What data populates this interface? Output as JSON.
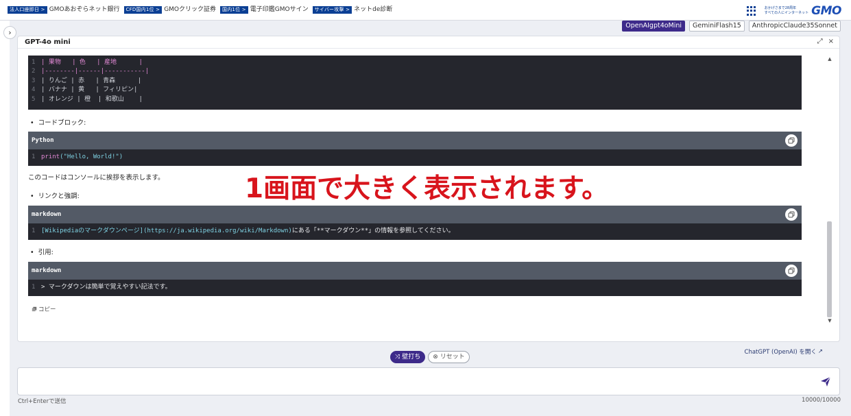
{
  "topbar": {
    "links": [
      {
        "tag": "法人口座即日 >",
        "label": "GMOあおぞらネット銀行"
      },
      {
        "tag": "CFD国内1位 >",
        "label": "GMOクリック証券"
      },
      {
        "tag": "国内1位 >",
        "label": "電子印鑑GMOサイン"
      },
      {
        "tag": "サイバー攻撃 >",
        "label": "ネットde診断"
      }
    ],
    "anniv_line1": "おかげさまで28周年",
    "anniv_line2": "すべての人にインターネット",
    "logo": "GMO"
  },
  "model_tabs": [
    {
      "label": "OpenAIgpt4oMini",
      "active": true
    },
    {
      "label": "GeminiFlash15",
      "active": false
    },
    {
      "label": "AnthropicClaude35Sonnet",
      "active": false
    }
  ],
  "panel": {
    "title": "GPT-4o mini",
    "table_code": [
      {
        "num": "1",
        "text": "| 果物   | 色   | 産地      |"
      },
      {
        "num": "2",
        "text": "|--------|------|-----------|"
      },
      {
        "num": "3",
        "text": "| りんご | 赤   | 青森      |"
      },
      {
        "num": "4",
        "text": "| バナナ | 黄   | フィリピン|"
      },
      {
        "num": "5",
        "text": "| オレンジ | 橙  | 和歌山    |"
      }
    ],
    "bullet_codeblock": "コードブロック:",
    "python_block": {
      "lang": "Python",
      "num": "1",
      "code_fn": "print",
      "code_rest": "(\"Hello, World!\")"
    },
    "python_desc": "このコードはコンソールに挨拶を表示します。",
    "bullet_link": "リンクと強調:",
    "link_block": {
      "lang": "markdown",
      "num": "1",
      "code_link": "[Wikipediaのマークダウンページ](https://ja.wikipedia.org/wiki/Markdown)",
      "code_rest": "にある「**マークダウン**」の情報を参照してください。"
    },
    "bullet_quote": "引用:",
    "quote_block": {
      "lang": "markdown",
      "num": "1",
      "code": "> マークダウンは簡単で覚えやすい記法です。"
    },
    "copy_label": "コピー",
    "open_link": "ChatGPT (OpenAI) を開く"
  },
  "overlay_text": "1画面で大きく表示されます。",
  "buttons": {
    "primary": "壁打ち",
    "reset": "リセット"
  },
  "input": {
    "placeholder": "",
    "hint": "Ctrl+Enterで送信",
    "counter": "10000/10000"
  },
  "colors": {
    "accent": "#3d2a8a",
    "overlay": "#d8141c",
    "code_bg": "#25262d",
    "code_head": "#535a66"
  }
}
